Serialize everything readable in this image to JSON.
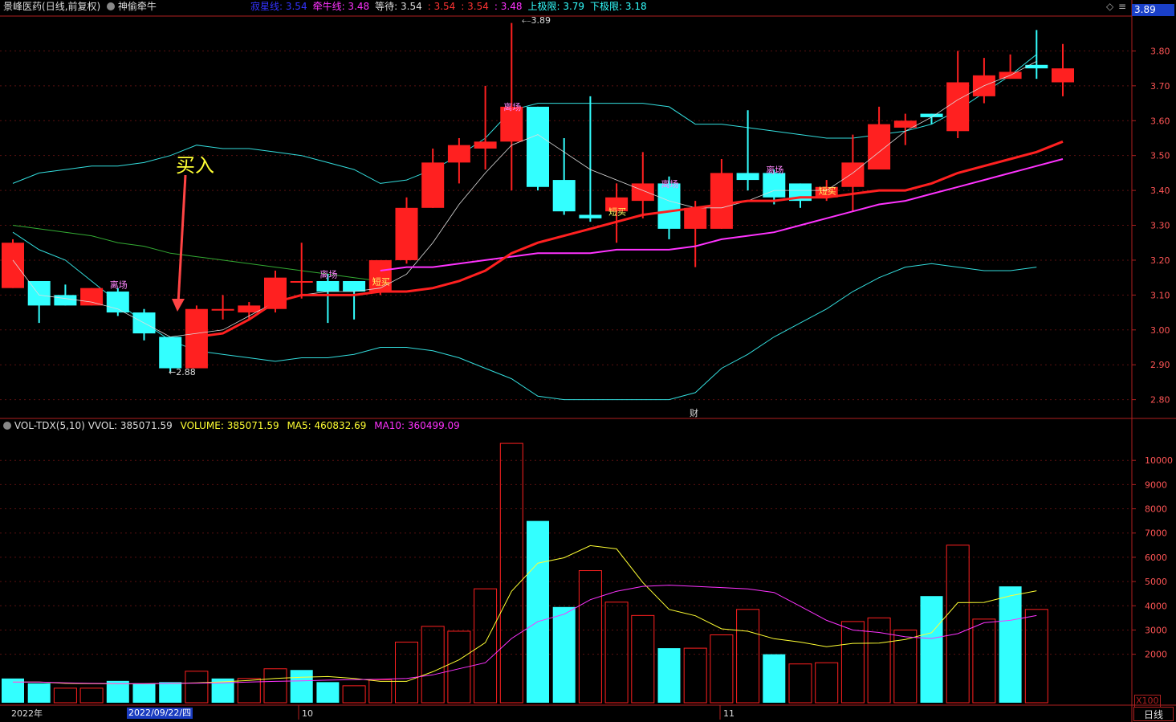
{
  "header": {
    "stock_name": "景峰医药",
    "period": "(日线,前复权)",
    "indicator_name": "神偷牵牛",
    "items": [
      {
        "label": "寂星线:",
        "value": "3.54",
        "color": "#3333ff"
      },
      {
        "label": "牵牛线:",
        "value": "3.48",
        "color": "#ff33ff"
      },
      {
        "label": "等待:",
        "value": "3.54",
        "color": "#dddddd"
      },
      {
        "label": "",
        "value": ": 3.54",
        "color": "#ff3333"
      },
      {
        "label": "",
        "value": ": 3.54",
        "color": "#ff3333"
      },
      {
        "label": "",
        "value": ": 3.48",
        "color": "#ff33ff"
      },
      {
        "label": "上极限:",
        "value": "3.79",
        "color": "#33ffff"
      },
      {
        "label": "下极限:",
        "value": "3.18",
        "color": "#33ffff"
      }
    ],
    "current_price_tag": "3.89"
  },
  "volume_header": {
    "name": "VOL-TDX(5,10)",
    "vvol": "VVOL: 385071.59",
    "volume": "VOLUME: 385071.59",
    "ma5": "MA5: 460832.69",
    "ma10": "MA10: 360499.09"
  },
  "annotations": {
    "buy_text": "买入",
    "high_label": "3.89",
    "low_label": "2.88",
    "finance_marker": "财",
    "signal_labels": [
      "离场",
      "短买"
    ]
  },
  "footer": {
    "year_label": "2022年",
    "date_label": "2022/09/22/四",
    "month_oct": "10",
    "month_nov": "11",
    "period_button": "日线",
    "volume_unit": "X100"
  },
  "colors": {
    "up": "#ff2020",
    "down": "#33ffff",
    "axis": "#b02020",
    "grid": "#5a1010",
    "mid_line": "#ff2020",
    "ma_purple": "#ff33ff",
    "band": "#33dddd",
    "ma5_vol": "#ffff33",
    "ma10_vol": "#ff33ff"
  },
  "chart_data": [
    {
      "type": "candlestick",
      "price_axis_ticks": [
        "3.80",
        "3.70",
        "3.60",
        "3.50",
        "3.40",
        "3.30",
        "3.20",
        "3.10",
        "3.00",
        "2.90",
        "2.80"
      ],
      "ylim": [
        2.76,
        3.9
      ],
      "candles": [
        {
          "o": 3.12,
          "h": 3.26,
          "l": 3.12,
          "c": 3.25
        },
        {
          "o": 3.14,
          "h": 3.14,
          "l": 3.02,
          "c": 3.07
        },
        {
          "o": 3.1,
          "h": 3.13,
          "l": 3.07,
          "c": 3.07
        },
        {
          "o": 3.07,
          "h": 3.12,
          "l": 3.07,
          "c": 3.12
        },
        {
          "o": 3.11,
          "h": 3.12,
          "l": 3.04,
          "c": 3.05
        },
        {
          "o": 3.05,
          "h": 3.06,
          "l": 2.97,
          "c": 2.99
        },
        {
          "o": 2.98,
          "h": 2.98,
          "l": 2.88,
          "c": 2.89
        },
        {
          "o": 2.89,
          "h": 3.07,
          "l": 2.89,
          "c": 3.06
        },
        {
          "o": 3.06,
          "h": 3.1,
          "l": 3.03,
          "c": 3.06
        },
        {
          "o": 3.05,
          "h": 3.08,
          "l": 3.03,
          "c": 3.07
        },
        {
          "o": 3.06,
          "h": 3.17,
          "l": 3.05,
          "c": 3.15
        },
        {
          "o": 3.14,
          "h": 3.25,
          "l": 3.09,
          "c": 3.14
        },
        {
          "o": 3.14,
          "h": 3.16,
          "l": 3.02,
          "c": 3.11
        },
        {
          "o": 3.14,
          "h": 3.14,
          "l": 3.03,
          "c": 3.11
        },
        {
          "o": 3.11,
          "h": 3.2,
          "l": 3.1,
          "c": 3.2
        },
        {
          "o": 3.2,
          "h": 3.38,
          "l": 3.19,
          "c": 3.35
        },
        {
          "o": 3.35,
          "h": 3.52,
          "l": 3.35,
          "c": 3.48
        },
        {
          "o": 3.48,
          "h": 3.55,
          "l": 3.42,
          "c": 3.53
        },
        {
          "o": 3.52,
          "h": 3.7,
          "l": 3.46,
          "c": 3.54
        },
        {
          "o": 3.54,
          "h": 3.88,
          "l": 3.4,
          "c": 3.64
        },
        {
          "o": 3.64,
          "h": 3.64,
          "l": 3.4,
          "c": 3.41
        },
        {
          "o": 3.43,
          "h": 3.55,
          "l": 3.33,
          "c": 3.34
        },
        {
          "o": 3.33,
          "h": 3.67,
          "l": 3.31,
          "c": 3.32
        },
        {
          "o": 3.34,
          "h": 3.42,
          "l": 3.25,
          "c": 3.38
        },
        {
          "o": 3.37,
          "h": 3.51,
          "l": 3.32,
          "c": 3.42
        },
        {
          "o": 3.42,
          "h": 3.44,
          "l": 3.26,
          "c": 3.29
        },
        {
          "o": 3.29,
          "h": 3.37,
          "l": 3.18,
          "c": 3.35
        },
        {
          "o": 3.29,
          "h": 3.49,
          "l": 3.29,
          "c": 3.45
        },
        {
          "o": 3.45,
          "h": 3.63,
          "l": 3.4,
          "c": 3.43
        },
        {
          "o": 3.45,
          "h": 3.46,
          "l": 3.36,
          "c": 3.38
        },
        {
          "o": 3.42,
          "h": 3.42,
          "l": 3.35,
          "c": 3.37
        },
        {
          "o": 3.38,
          "h": 3.43,
          "l": 3.37,
          "c": 3.41
        },
        {
          "o": 3.41,
          "h": 3.56,
          "l": 3.34,
          "c": 3.48
        },
        {
          "o": 3.46,
          "h": 3.64,
          "l": 3.46,
          "c": 3.59
        },
        {
          "o": 3.58,
          "h": 3.62,
          "l": 3.53,
          "c": 3.6
        },
        {
          "o": 3.62,
          "h": 3.62,
          "l": 3.59,
          "c": 3.61
        },
        {
          "o": 3.57,
          "h": 3.8,
          "l": 3.55,
          "c": 3.71
        },
        {
          "o": 3.67,
          "h": 3.78,
          "l": 3.65,
          "c": 3.73
        },
        {
          "o": 3.72,
          "h": 3.79,
          "l": 3.72,
          "c": 3.74
        },
        {
          "o": 3.76,
          "h": 3.86,
          "l": 3.72,
          "c": 3.75
        },
        {
          "o": 3.71,
          "h": 3.82,
          "l": 3.67,
          "c": 3.75
        }
      ],
      "upper_band": [
        3.42,
        3.45,
        3.46,
        3.47,
        3.47,
        3.48,
        3.5,
        3.53,
        3.52,
        3.52,
        3.51,
        3.5,
        3.48,
        3.46,
        3.42,
        3.43,
        3.46,
        3.5,
        3.55,
        3.63,
        3.65,
        3.65,
        3.65,
        3.65,
        3.65,
        3.64,
        3.59,
        3.59,
        3.58,
        3.57,
        3.56,
        3.55,
        3.55,
        3.56,
        3.57,
        3.59,
        3.63,
        3.68,
        3.73,
        3.79
      ],
      "lower_band": [
        3.28,
        3.23,
        3.2,
        3.14,
        3.08,
        3.02,
        2.97,
        2.94,
        2.93,
        2.92,
        2.91,
        2.92,
        2.92,
        2.93,
        2.95,
        2.95,
        2.94,
        2.92,
        2.89,
        2.86,
        2.81,
        2.8,
        2.8,
        2.8,
        2.8,
        2.8,
        2.82,
        2.89,
        2.93,
        2.98,
        3.02,
        3.06,
        3.11,
        3.15,
        3.18,
        3.19,
        3.18,
        3.17,
        3.17,
        3.18
      ],
      "ma_green": [
        3.3,
        3.29,
        3.28,
        3.27,
        3.25,
        3.24,
        3.22,
        3.21,
        3.2,
        3.19,
        3.18,
        3.17,
        3.16,
        3.15,
        3.14
      ],
      "mid_red": [
        2.98,
        2.99,
        3.03,
        3.08,
        3.1,
        3.1,
        3.1,
        3.11,
        3.11,
        3.12,
        3.14,
        3.17,
        3.22,
        3.25,
        3.27,
        3.29,
        3.31,
        3.33,
        3.34,
        3.35,
        3.36,
        3.37,
        3.37,
        3.38,
        3.38,
        3.39,
        3.4,
        3.4,
        3.42,
        3.45,
        3.47,
        3.49,
        3.51,
        3.54
      ],
      "ma_purple": [
        3.17,
        3.18,
        3.18,
        3.19,
        3.2,
        3.21,
        3.22,
        3.22,
        3.22,
        3.23,
        3.23,
        3.23,
        3.24,
        3.26,
        3.27,
        3.28,
        3.3,
        3.32,
        3.34,
        3.36,
        3.37,
        3.39,
        3.41,
        3.43,
        3.45,
        3.47,
        3.49
      ],
      "thin_white": [
        3.2,
        3.1,
        3.09,
        3.08,
        3.06,
        3.02,
        2.98,
        2.99,
        3.0,
        3.04,
        3.08,
        3.1,
        3.11,
        3.11,
        3.12,
        3.16,
        3.25,
        3.36,
        3.45,
        3.53,
        3.56,
        3.51,
        3.46,
        3.43,
        3.4,
        3.37,
        3.35,
        3.35,
        3.37,
        3.4,
        3.4,
        3.4,
        3.45,
        3.51,
        3.57,
        3.61,
        3.66,
        3.7,
        3.73,
        3.77
      ]
    },
    {
      "type": "bar",
      "volume_axis_ticks": [
        "10000",
        "9000",
        "8000",
        "7000",
        "6000",
        "5000",
        "4000",
        "3000",
        "2000"
      ],
      "ylim": [
        0,
        11100
      ],
      "values": [
        1000,
        800,
        600,
        600,
        900,
        800,
        850,
        1300,
        1000,
        1000,
        1400,
        1350,
        850,
        700,
        950,
        2500,
        3150,
        2950,
        4700,
        10700,
        7500,
        3950,
        5450,
        4150,
        3600,
        2250,
        2250,
        2800,
        3850,
        2000,
        1600,
        1650,
        3350,
        3500,
        3000,
        4400,
        6500,
        3450,
        4800,
        3850
      ],
      "down_flags": [
        1,
        1,
        0,
        0,
        1,
        1,
        1,
        0,
        1,
        0,
        0,
        1,
        1,
        0,
        0,
        0,
        0,
        0,
        0,
        0,
        1,
        1,
        0,
        0,
        0,
        1,
        0,
        0,
        0,
        1,
        0,
        0,
        0,
        0,
        0,
        1,
        0,
        0,
        1,
        0
      ],
      "ma5": [
        850,
        850,
        800,
        790,
        780,
        780,
        800,
        820,
        860,
        920,
        1000,
        1050,
        1080,
        1000,
        880,
        880,
        1280,
        1770,
        2480,
        4600,
        5760,
        5980,
        6480,
        6350,
        4960,
        3850,
        3590,
        3050,
        2950,
        2640,
        2500,
        2310,
        2450,
        2460,
        2610,
        2890,
        4130,
        4140,
        4410,
        4620
      ],
      "ma10": [
        850,
        850,
        820,
        800,
        790,
        790,
        800,
        810,
        820,
        850,
        880,
        900,
        930,
        950,
        970,
        1000,
        1150,
        1400,
        1650,
        2650,
        3350,
        3650,
        4250,
        4600,
        4800,
        4850,
        4800,
        4750,
        4700,
        4550,
        3980,
        3400,
        3000,
        2900,
        2720,
        2650,
        2850,
        3300,
        3400,
        3600
      ]
    }
  ]
}
